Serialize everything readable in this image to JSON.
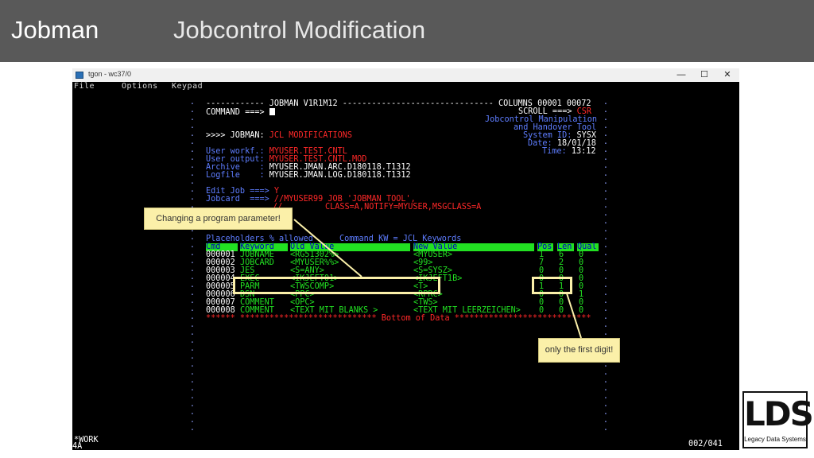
{
  "slide": {
    "app": "Jobman",
    "title": "Jobcontrol Modification"
  },
  "window": {
    "title": "tgon - wc37/0",
    "controls": [
      "—",
      "☐",
      "✕"
    ],
    "menu": [
      "File",
      "Options",
      "Keypad"
    ]
  },
  "terminal": {
    "line1": "------------ JOBMAN V1R1M12 ------------------------------- COLUMNS 00001 00072",
    "command_label": "COMMAND ===> ",
    "scroll_label": "SCROLL ===> ",
    "scroll_value": "CSR",
    "tool1": "Jobcontrol Manipulation",
    "tool2": "and Handover Tool",
    "prompt": ">>>> JOBMAN: ",
    "prompt_value": "JCL MODIFICATIONS",
    "system_label": "System ID: ",
    "system_value": "SYSX",
    "date_label": "Date: ",
    "date_value": "18/01/18",
    "time_label": "Time: ",
    "time_value": "13:12",
    "userworkf_label": "User workf.: ",
    "userworkf_value": "MYUSER.TEST.CNTL",
    "useroutput_label": "User output: ",
    "useroutput_value": "MYUSER.TEST.CNTL.MOD",
    "archive_label": "Archive    : ",
    "archive_value": "MYUSER.JMAN.ARC.D180118.T1312",
    "logfile_label": "Logfile    : ",
    "logfile_value": "MYUSER.JMAN.LOG.D180118.T1312",
    "editjob_label": "Edit Job ===> ",
    "editjob_value": "Y",
    "jobcard_label": "Jobcard  ===> ",
    "jobcard_value1": "//MYUSER99 JOB 'JOBMAN TOOL',",
    "jobcard_cont": "//",
    "jobcard_value2": "CLASS=A,NOTIFY=MYUSER,MSGCLASS=A",
    "placeholders": "Placeholders % allowed",
    "command_kw": "Command KW = JCL Keywords",
    "table": {
      "headers": [
        "Cmd",
        "Keyword",
        "Old Value",
        "New Value",
        "Pos",
        "Len",
        "Qual"
      ],
      "rows": [
        [
          "000001",
          "JOBNAME",
          "<RG51302%>",
          "<MYUSER>",
          "1",
          "6",
          "0"
        ],
        [
          "000002",
          "JOBCARD",
          "<MYUSER%%>",
          "<99>",
          "7",
          "2",
          "0"
        ],
        [
          "000003",
          "JES",
          "<S=ANY>",
          "<S=SYSZ>",
          "0",
          "0",
          "0"
        ],
        [
          "000004",
          "EXEC",
          "<IKJEFT01>",
          "<IKJEFT1B>",
          "0",
          "0",
          "0"
        ],
        [
          "000005",
          "PARM",
          "<TWSCOMP>",
          "<T>",
          "1",
          "1",
          "0"
        ],
        [
          "000006",
          "DSN",
          "<PPC>",
          "<RPRC>",
          "0",
          "0",
          "1"
        ],
        [
          "000007",
          "COMMENT",
          "<OPC>",
          "<TWS>",
          "0",
          "0",
          "0"
        ],
        [
          "000008",
          "COMMENT",
          "<TEXT MIT BLANKS >",
          "<TEXT MIT LEERZEICHEN>",
          "0",
          "0",
          "0"
        ]
      ]
    },
    "bottom": "****** **************************** Bottom of Data ****************************",
    "status_left": "4A",
    "status_work": "*WORK",
    "status_right": "002/041"
  },
  "callouts": {
    "left": "Changing a program parameter!",
    "right": "only the first digit!"
  },
  "logo": {
    "mark": "LDS",
    "sub": "Legacy Data Systems"
  },
  "colors": {
    "header_bg": "#595959",
    "terminal_bg": "#000000",
    "field_blue": "#5e7dff",
    "value_red": "#ff2828",
    "table_green": "#22e022",
    "callout_bg": "#fbf0a9"
  }
}
